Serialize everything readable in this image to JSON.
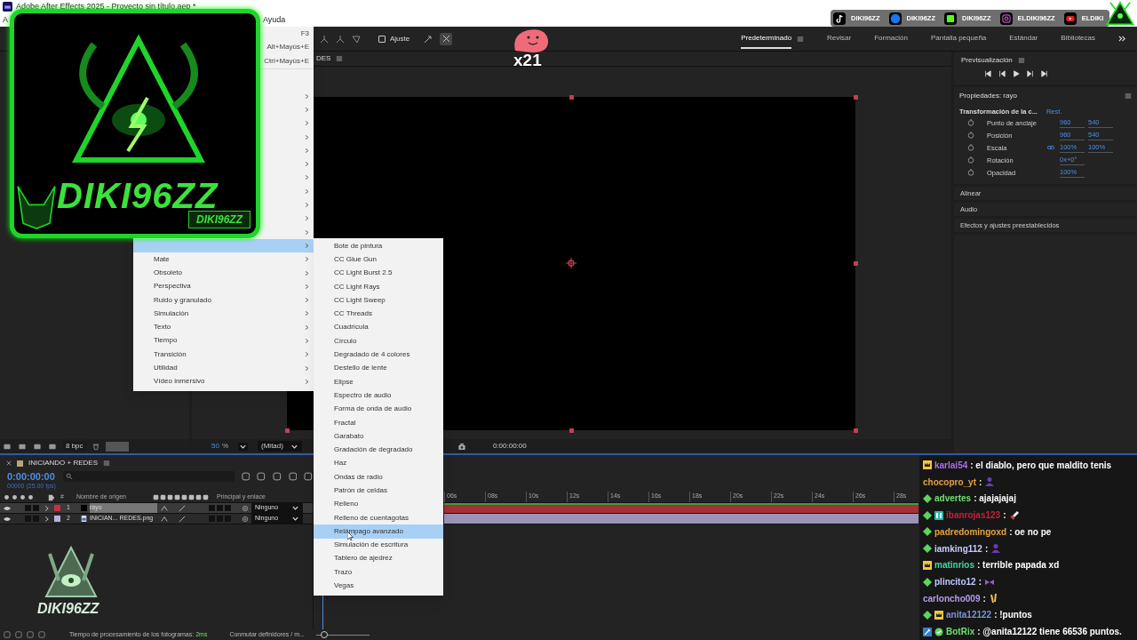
{
  "window": {
    "title": "Adobe After Effects 2025 - Proyecto sin título.aep *"
  },
  "menu_bar": [
    "A",
    "Ayuda"
  ],
  "toolbar": {
    "snap": {
      "label": "Ajuste",
      "checked": false
    }
  },
  "workspaces": [
    {
      "label": "Predeterminado",
      "selected": true
    },
    {
      "label": "Revisar",
      "selected": false
    },
    {
      "label": "Formación",
      "selected": false
    },
    {
      "label": "Pantalla pequeña",
      "selected": false
    },
    {
      "label": "Estándar",
      "selected": false
    },
    {
      "label": "Bibliotecas",
      "selected": false
    }
  ],
  "effect_menu": {
    "shortcuts": [
      "F3",
      "Alt+Mayús+E",
      "Ctrl+Mayús+E"
    ],
    "items": [
      {
        "kind": "submenu",
        "selected": false
      },
      {
        "kind": "submenu",
        "selected": false
      },
      {
        "kind": "submenu",
        "selected": false
      },
      {
        "kind": "submenu",
        "selected": false
      },
      {
        "kind": "submenu",
        "selected": false
      },
      {
        "kind": "submenu",
        "selected": false
      },
      {
        "kind": "submenu",
        "selected": false
      },
      {
        "kind": "submenu",
        "selected": false
      },
      {
        "kind": "submenu",
        "selected": false
      },
      {
        "kind": "submenu",
        "selected": false
      },
      {
        "kind": "submenu",
        "selected": false
      },
      {
        "kind": "submenu",
        "selected": true
      },
      {
        "kind": "submenu",
        "label": "Mate",
        "selected": false
      },
      {
        "kind": "submenu",
        "label": "Obsoleto",
        "selected": false
      },
      {
        "kind": "submenu",
        "label": "Perspectiva",
        "selected": false
      },
      {
        "kind": "submenu",
        "label": "Ruido y granulado",
        "selected": false
      },
      {
        "kind": "submenu",
        "label": "Simulación",
        "selected": false
      },
      {
        "kind": "submenu",
        "label": "Texto",
        "selected": false
      },
      {
        "kind": "submenu",
        "label": "Tiempo",
        "selected": false
      },
      {
        "kind": "submenu",
        "label": "Transición",
        "selected": false
      },
      {
        "kind": "submenu",
        "label": "Utilidad",
        "selected": false
      },
      {
        "kind": "submenu",
        "label": "Vídeo inmersivo",
        "selected": false
      }
    ]
  },
  "effect_submenu": [
    {
      "label": "Bote de pintura",
      "selected": false
    },
    {
      "label": "CC Glue Gun",
      "selected": false
    },
    {
      "label": "CC Light Burst 2.5",
      "selected": false
    },
    {
      "label": "CC Light Rays",
      "selected": false
    },
    {
      "label": "CC Light Sweep",
      "selected": false
    },
    {
      "label": "CC Threads",
      "selected": false
    },
    {
      "label": "Cuadrícula",
      "selected": false
    },
    {
      "label": "Círculo",
      "selected": false
    },
    {
      "label": "Degradado de 4 colores",
      "selected": false
    },
    {
      "label": "Destello de lente",
      "selected": false
    },
    {
      "label": "Elipse",
      "selected": false
    },
    {
      "label": "Espectro de audio",
      "selected": false
    },
    {
      "label": "Forma de onda de audio",
      "selected": false
    },
    {
      "label": "Fractal",
      "selected": false
    },
    {
      "label": "Garabato",
      "selected": false
    },
    {
      "label": "Gradación de degradado",
      "selected": false
    },
    {
      "label": "Haz",
      "selected": false
    },
    {
      "label": "Ondas de radio",
      "selected": false
    },
    {
      "label": "Patrón de celdas",
      "selected": false
    },
    {
      "label": "Relleno",
      "selected": false
    },
    {
      "label": "Relleno de cuentagotas",
      "selected": false
    },
    {
      "label": "Relámpago avanzado",
      "selected": true
    },
    {
      "label": "Simulación de escritura",
      "selected": false
    },
    {
      "label": "Tablero de ajedrez",
      "selected": false
    },
    {
      "label": "Trazo",
      "selected": false
    },
    {
      "label": "Vegas",
      "selected": false
    }
  ],
  "project_footer": {
    "bit_depth": "8 bpc"
  },
  "composition": {
    "tab": "DES",
    "zoom_value": "50",
    "zoom_unit": "%",
    "resolution": "(Mitad)",
    "time": "0:00:00:00"
  },
  "preview": {
    "title": "Previsualización"
  },
  "properties": {
    "title": "Propiedades: rayo",
    "group": "Transformación de la c...",
    "reset": "Rest.",
    "rows": [
      {
        "label": "Punto de anclaje",
        "values": [
          "960",
          "540"
        ],
        "linked": false
      },
      {
        "label": "Posición",
        "values": [
          "960",
          "540"
        ],
        "linked": false
      },
      {
        "label": "Escala",
        "values": [
          "100%",
          "100%"
        ],
        "linked": true
      },
      {
        "label": "Rotación",
        "values": [
          "0x+0°"
        ],
        "linked": false
      },
      {
        "label": "Opacidad",
        "values": [
          "100%"
        ],
        "linked": false
      }
    ]
  },
  "panels": [
    "Alinear",
    "Audio",
    "Efectos y ajustes preestablecidos"
  ],
  "timeline": {
    "tab": "INICIANDO + REDES",
    "time": "0:00:00:00",
    "frames": "00000 (25.00 fps)",
    "columns": {
      "number": "#",
      "name": "Nombre de origen",
      "parent": "Principal y enlace"
    },
    "layers": [
      {
        "number": "1",
        "name": "rayo",
        "kind": "solid",
        "color": "#c8323f",
        "parent": "Ninguno",
        "selected": true
      },
      {
        "number": "2",
        "name": "INICIAN... REDES.png",
        "kind": "image",
        "color": "#b9b1dc",
        "parent": "Ninguno",
        "selected": false
      }
    ],
    "ruler": [
      "06s",
      "08s",
      "10s",
      "12s",
      "14s",
      "16s",
      "18s",
      "20s",
      "22s",
      "24s",
      "26s",
      "28s"
    ]
  },
  "status_bar": {
    "render_label": "Tiempo de procesamiento de los fotogramas:",
    "render_time": "2ms",
    "toggle": "Conmutar definidores / m...",
    "zoom_slider": {
      "level": 0.15
    }
  },
  "overlay": {
    "webcam_name": "DIKI96ZZ",
    "webcam_tag": "DIKI96ZZ",
    "alert_count": "x21",
    "corner_logo": "DIKI96ZZ",
    "socials": [
      {
        "kind": "tiktok",
        "handle": "DIKI96ZZ"
      },
      {
        "kind": "facebook",
        "handle": "DIKI96ZZ"
      },
      {
        "kind": "kick",
        "handle": "DIKI96ZZ"
      },
      {
        "kind": "instagram",
        "handle": "ELDIKI96ZZ"
      },
      {
        "kind": "youtube",
        "handle": "ELDIKI"
      }
    ]
  },
  "chat": [
    {
      "badges": [
        {
          "kind": "crown"
        }
      ],
      "user": "karlai54",
      "color": "#a970e0",
      "text": ": el diablo, pero que maldito tenis"
    },
    {
      "user": "chocopro_yt",
      "color": "#e6a23c",
      "text": ":",
      "emote": {
        "kind": "figure"
      }
    },
    {
      "badges": [
        {
          "kind": "diamond"
        }
      ],
      "user": "advertes",
      "color": "#6ee06e",
      "text": ": ajajajajaj"
    },
    {
      "badges": [
        {
          "kind": "diamond"
        },
        {
          "kind": "glitch"
        }
      ],
      "user": "ibanrojas123",
      "color": "#c8203c",
      "text": ":",
      "emote": {
        "kind": "rocket"
      }
    },
    {
      "badges": [
        {
          "kind": "diamond"
        }
      ],
      "user": "padredomingoxd",
      "color": "#e6a23c",
      "text": ": oe no pe"
    },
    {
      "badges": [
        {
          "kind": "diamond"
        }
      ],
      "user": "iamking112",
      "color": "#c8ccff",
      "text": ":",
      "emote": {
        "kind": "figure"
      }
    },
    {
      "badges": [
        {
          "kind": "crown"
        }
      ],
      "user": "matinrios",
      "color": "#3fd6a6",
      "text": ": terrible papada xd"
    },
    {
      "badges": [
        {
          "kind": "diamond"
        }
      ],
      "user": "plincito12",
      "color": "#c0c8ff",
      "text": ":",
      "emote": {
        "kind": "bow"
      }
    },
    {
      "user": "carloncho009",
      "color": "#b59ae6",
      "text": ":",
      "emote": {
        "kind": "sparkle"
      }
    },
    {
      "badges": [
        {
          "kind": "diamond"
        },
        {
          "kind": "crown"
        }
      ],
      "user": "anita12122",
      "color": "#7b96d6",
      "text": ": !puntos"
    },
    {
      "badges": [
        {
          "kind": "tool"
        },
        {
          "kind": "verified"
        }
      ],
      "user": "BotRix",
      "color": "#6ee06e",
      "text": ": @anita12122 tiene 66536 puntos."
    }
  ]
}
